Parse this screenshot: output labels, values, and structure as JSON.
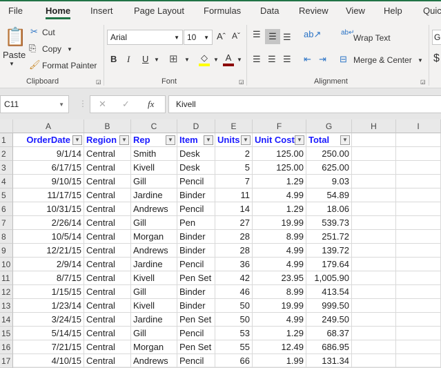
{
  "tabs": [
    "File",
    "Home",
    "Insert",
    "Page Layout",
    "Formulas",
    "Data",
    "Review",
    "View",
    "Help",
    "Quic"
  ],
  "active_tab": "Home",
  "clipboard": {
    "paste": "Paste",
    "cut": "Cut",
    "copy": "Copy",
    "format_painter": "Format Painter",
    "label": "Clipboard"
  },
  "font": {
    "name": "Arial",
    "size": "10",
    "label": "Font",
    "bold": "B",
    "italic": "I",
    "underline": "U",
    "font_color": "#c00000",
    "highlight_color": "#ffff00"
  },
  "alignment": {
    "wrap_text": "Wrap Text",
    "merge_center": "Merge & Center",
    "label": "Alignment"
  },
  "number": {
    "format": "G",
    "currency": "$"
  },
  "name_box": "C11",
  "formula": "Kivell",
  "columns": [
    "A",
    "B",
    "C",
    "D",
    "E",
    "F",
    "G",
    "H",
    "I"
  ],
  "headers": [
    "OrderDate",
    "Region",
    "Rep",
    "Item",
    "Units",
    "Unit Cost",
    "Total"
  ],
  "rows": [
    [
      "9/1/14",
      "Central",
      "Smith",
      "Desk",
      "2",
      "125.00",
      "250.00"
    ],
    [
      "6/17/15",
      "Central",
      "Kivell",
      "Desk",
      "5",
      "125.00",
      "625.00"
    ],
    [
      "9/10/15",
      "Central",
      "Gill",
      "Pencil",
      "7",
      "1.29",
      "9.03"
    ],
    [
      "11/17/15",
      "Central",
      "Jardine",
      "Binder",
      "11",
      "4.99",
      "54.89"
    ],
    [
      "10/31/15",
      "Central",
      "Andrews",
      "Pencil",
      "14",
      "1.29",
      "18.06"
    ],
    [
      "2/26/14",
      "Central",
      "Gill",
      "Pen",
      "27",
      "19.99",
      "539.73"
    ],
    [
      "10/5/14",
      "Central",
      "Morgan",
      "Binder",
      "28",
      "8.99",
      "251.72"
    ],
    [
      "12/21/15",
      "Central",
      "Andrews",
      "Binder",
      "28",
      "4.99",
      "139.72"
    ],
    [
      "2/9/14",
      "Central",
      "Jardine",
      "Pencil",
      "36",
      "4.99",
      "179.64"
    ],
    [
      "8/7/15",
      "Central",
      "Kivell",
      "Pen Set",
      "42",
      "23.95",
      "1,005.90"
    ],
    [
      "1/15/15",
      "Central",
      "Gill",
      "Binder",
      "46",
      "8.99",
      "413.54"
    ],
    [
      "1/23/14",
      "Central",
      "Kivell",
      "Binder",
      "50",
      "19.99",
      "999.50"
    ],
    [
      "3/24/15",
      "Central",
      "Jardine",
      "Pen Set",
      "50",
      "4.99",
      "249.50"
    ],
    [
      "5/14/15",
      "Central",
      "Gill",
      "Pencil",
      "53",
      "1.29",
      "68.37"
    ],
    [
      "7/21/15",
      "Central",
      "Morgan",
      "Pen Set",
      "55",
      "12.49",
      "686.95"
    ],
    [
      "4/10/15",
      "Central",
      "Andrews",
      "Pencil",
      "66",
      "1.99",
      "131.34"
    ]
  ]
}
